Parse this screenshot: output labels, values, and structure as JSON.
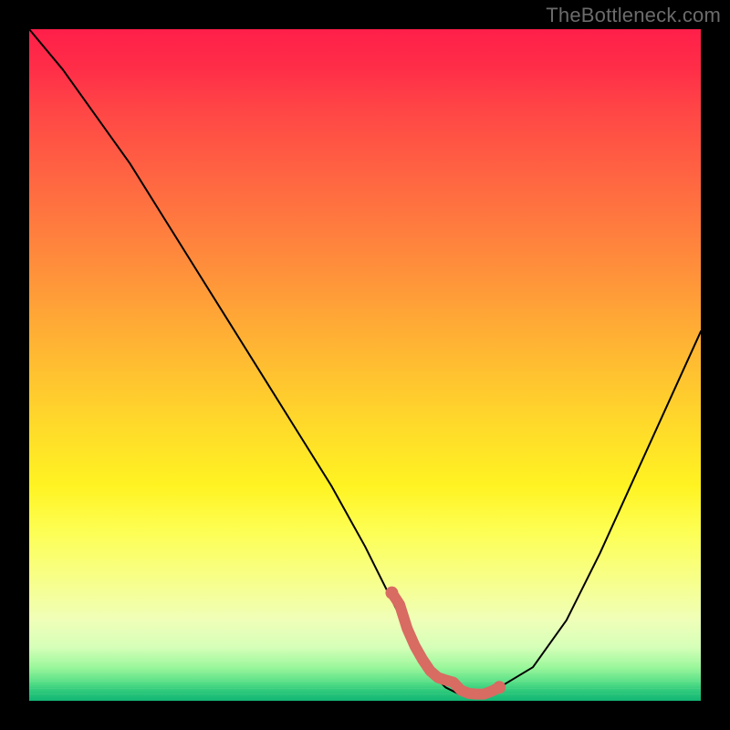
{
  "watermark": "TheBottleneck.com",
  "chart_data": {
    "type": "line",
    "title": "",
    "xlabel": "",
    "ylabel": "",
    "xlim": [
      0,
      100
    ],
    "ylim": [
      0,
      100
    ],
    "grid": false,
    "legend": false,
    "series": [
      {
        "name": "curve",
        "x": [
          0,
          5,
          10,
          15,
          20,
          25,
          30,
          35,
          40,
          45,
          50,
          52,
          54,
          56,
          58,
          60,
          62,
          64,
          66,
          68,
          70,
          75,
          80,
          85,
          90,
          95,
          100
        ],
        "y": [
          100,
          94,
          87,
          80,
          72,
          64,
          56,
          48,
          40,
          32,
          23,
          19,
          15,
          11,
          7,
          4,
          2,
          1,
          1,
          1,
          2,
          5,
          12,
          22,
          33,
          44,
          55
        ]
      }
    ],
    "highlight_region": {
      "x_start": 54,
      "x_end": 70,
      "description": "bottom of curve marked in thick salmon stroke with two bumps"
    },
    "background": "continuous vertical gradient red→orange→yellow→green"
  }
}
